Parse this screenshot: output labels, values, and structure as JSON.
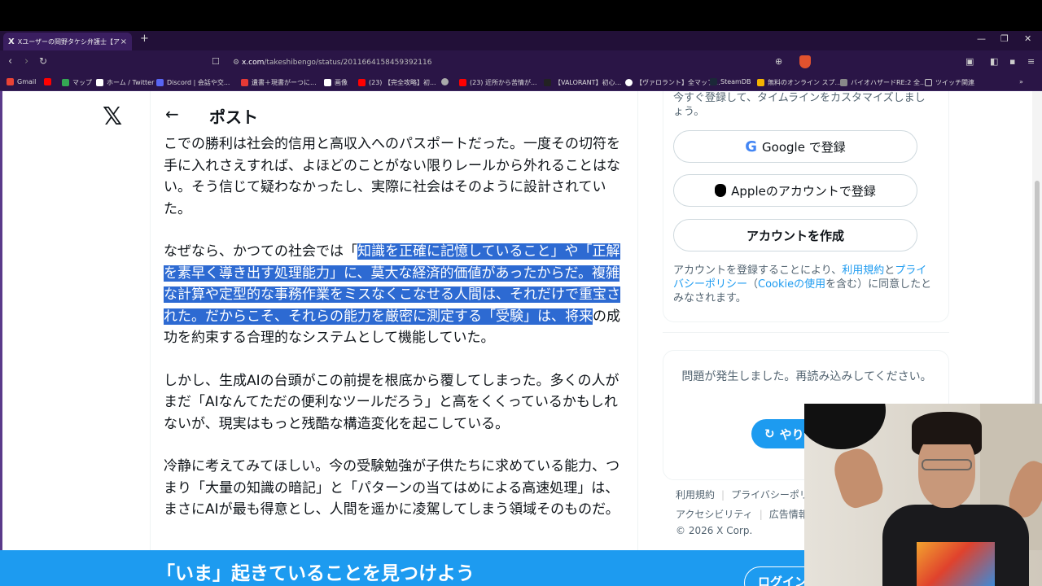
{
  "browser": {
    "tab_title": "Xユーザーの岡野タケシ弁護士【アトム",
    "tab_close": "×",
    "new_tab": "+",
    "url_host": "x.com",
    "url_path": "/takeshibengo/status/2011664158459392116",
    "bookmarks": [
      {
        "label": "Gmail",
        "color": "#ea4335"
      },
      {
        "label": "",
        "color": "#ff0000"
      },
      {
        "label": "マップ",
        "color": "#34a853"
      },
      {
        "label": "ホーム / Twitter",
        "color": "#ffffff"
      },
      {
        "label": "Discord | 会話や交...",
        "color": "#5865f2"
      },
      {
        "label": "遺書＋現書がーつに...",
        "color": "#e53935"
      },
      {
        "label": "画像",
        "color": "#ffffff"
      },
      {
        "label": "(23) 【完全攻略】初...",
        "color": "#ff0000"
      },
      {
        "label": "",
        "color": "#aaaaaa"
      },
      {
        "label": "(23) 近所から苦情が...",
        "color": "#ff0000"
      },
      {
        "label": "【VALORANT】初心...",
        "color": "#222222"
      },
      {
        "label": "【ヴァロラント】全マップ...",
        "color": "#ffffff"
      },
      {
        "label": "SteamDB",
        "color": "#1b2838"
      },
      {
        "label": "無料のオンライン スプ...",
        "color": "#f4b400"
      },
      {
        "label": "バイオハザードRE:2 全...",
        "color": "#888888"
      },
      {
        "label": "ツイッチ関連",
        "color": "#cccccc"
      }
    ]
  },
  "post": {
    "back_arrow": "←",
    "title": "ポスト",
    "p1": "こでの勝利は社会的信用と高収入へのパスポートだった。一度その切符を手に入れさえすれば、よほどのことがない限りレールから外れることはない。そう信じて疑わなかったし、実際に社会はそのように設計されていた。",
    "p2_a": "なぜなら、かつての社会では「",
    "p2_hl": "知識を正確に記憶していること」や「正解を素早く導き出す処理能力」に、莫大な経済的価値があったからだ。複雑な計算や定型的な事務作業をミスなくこなせる人間は、それだけで重宝された。だからこそ、それらの能力を厳密に測定する「受験」は、将来",
    "p2_b": "の成功を約束する合理的なシステムとして機能していた。",
    "p3": "しかし、生成AIの台頭がこの前提を根底から覆してしまった。多くの人がまだ「AIなんてただの便利なツールだろう」と高をくくっているかもしれないが、現実はもっと残酷な構造変化を起こしている。",
    "p4": "冷静に考えてみてほしい。今の受験勉強が子供たちに求めている能力、つまり「大量の知識の暗記」と「パターンの当てはめによる高速処理」は、まさにAIが最も得意とし、人間を遥かに凌駕してしまう領域そのものだ。"
  },
  "signup": {
    "intro": "今すぐ登録して、タイムラインをカスタマイズしましょう。",
    "google": "Google で登録",
    "apple": "Appleのアカウントで登録",
    "create": "アカウントを作成",
    "legal_a": "アカウントを登録することにより、",
    "legal_terms": "利用規約",
    "legal_and": "と",
    "legal_privacy": "プライバシーポリシー",
    "legal_paren": "（",
    "legal_cookie": "Cookieの使用",
    "legal_b": "を含む）に同意したとみなされます。"
  },
  "error": {
    "message": "問題が発生しました。再読み込みしてください。",
    "retry": "やり"
  },
  "footer": {
    "terms": "利用規約",
    "privacy": "プライバシーポリ",
    "accessibility": "アクセシビリティ",
    "ads": "広告情報",
    "copyright": "© 2026 X Corp."
  },
  "banner": {
    "text": "「いま」起きていることを見つけよう",
    "login": "ログイン"
  }
}
